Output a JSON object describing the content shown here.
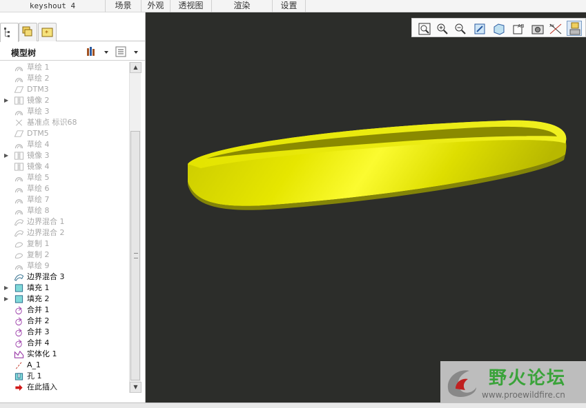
{
  "menu": {
    "app_title": "keyshout 4",
    "items": [
      "场景",
      "外观",
      "透视图",
      "渲染",
      "设置"
    ]
  },
  "panel": {
    "tree_title": "模型树",
    "tree_items": [
      {
        "label": "草绘 1",
        "icon": "sketch-icon",
        "state": "dim",
        "expand": false
      },
      {
        "label": "草绘 2",
        "icon": "sketch-icon",
        "state": "dim",
        "expand": false
      },
      {
        "label": "DTM3",
        "icon": "datum-plane-icon",
        "state": "dim",
        "expand": false
      },
      {
        "label": "镜像 2",
        "icon": "mirror-icon",
        "state": "dim",
        "expand": true
      },
      {
        "label": "草绘 3",
        "icon": "sketch-icon",
        "state": "dim",
        "expand": false
      },
      {
        "label": "基准点 标识68",
        "icon": "datum-point-icon",
        "state": "dim",
        "expand": false
      },
      {
        "label": "DTM5",
        "icon": "datum-plane-icon",
        "state": "dim",
        "expand": false
      },
      {
        "label": "草绘 4",
        "icon": "sketch-icon",
        "state": "dim",
        "expand": false
      },
      {
        "label": "镜像 3",
        "icon": "mirror-icon",
        "state": "dim",
        "expand": true
      },
      {
        "label": "镜像 4",
        "icon": "mirror-icon",
        "state": "dim",
        "expand": false
      },
      {
        "label": "草绘 5",
        "icon": "sketch-icon",
        "state": "dim",
        "expand": false
      },
      {
        "label": "草绘 6",
        "icon": "sketch-icon",
        "state": "dim",
        "expand": false
      },
      {
        "label": "草绘 7",
        "icon": "sketch-icon",
        "state": "dim",
        "expand": false
      },
      {
        "label": "草绘 8",
        "icon": "sketch-icon",
        "state": "dim",
        "expand": false
      },
      {
        "label": "边界混合 1",
        "icon": "boundary-blend-icon",
        "state": "dim",
        "expand": false
      },
      {
        "label": "边界混合 2",
        "icon": "boundary-blend-icon",
        "state": "dim",
        "expand": false
      },
      {
        "label": "复制 1",
        "icon": "copy-icon",
        "state": "dim",
        "expand": false
      },
      {
        "label": "复制 2",
        "icon": "copy-icon",
        "state": "dim",
        "expand": false
      },
      {
        "label": "草绘 9",
        "icon": "sketch-icon",
        "state": "dim",
        "expand": false
      },
      {
        "label": "边界混合 3",
        "icon": "boundary-blend-icon",
        "state": "active",
        "expand": false
      },
      {
        "label": "填充 1",
        "icon": "fill-icon",
        "state": "active",
        "expand": true
      },
      {
        "label": "填充 2",
        "icon": "fill-icon",
        "state": "active",
        "expand": true
      },
      {
        "label": "合并 1",
        "icon": "merge-icon",
        "state": "active",
        "expand": false
      },
      {
        "label": "合并 2",
        "icon": "merge-icon",
        "state": "active",
        "expand": false
      },
      {
        "label": "合并 3",
        "icon": "merge-icon",
        "state": "active",
        "expand": false
      },
      {
        "label": "合并 4",
        "icon": "merge-icon",
        "state": "active",
        "expand": false
      },
      {
        "label": "实体化 1",
        "icon": "solidify-icon",
        "state": "active",
        "expand": false
      },
      {
        "label": "A_1",
        "icon": "axis-icon",
        "state": "active",
        "expand": false
      },
      {
        "label": "孔 1",
        "icon": "hole-icon",
        "state": "active",
        "expand": false
      },
      {
        "label": "在此插入",
        "icon": "insert-here-icon",
        "state": "active",
        "expand": false
      }
    ]
  },
  "toolbar": {
    "buttons": [
      "zoom-fit-icon",
      "zoom-in-icon",
      "zoom-out-icon",
      "repaint-icon",
      "view-orient-icon",
      "saved-views-icon",
      "spin-center-icon",
      "datum-display-icon",
      "settings-icon"
    ]
  },
  "watermark": {
    "title": "野火论坛",
    "url": "www.proewildfire.cn"
  },
  "colors": {
    "viewport_bg": "#2c2d2a",
    "model": "#e0e000",
    "watermark_green": "#3aa33a"
  }
}
